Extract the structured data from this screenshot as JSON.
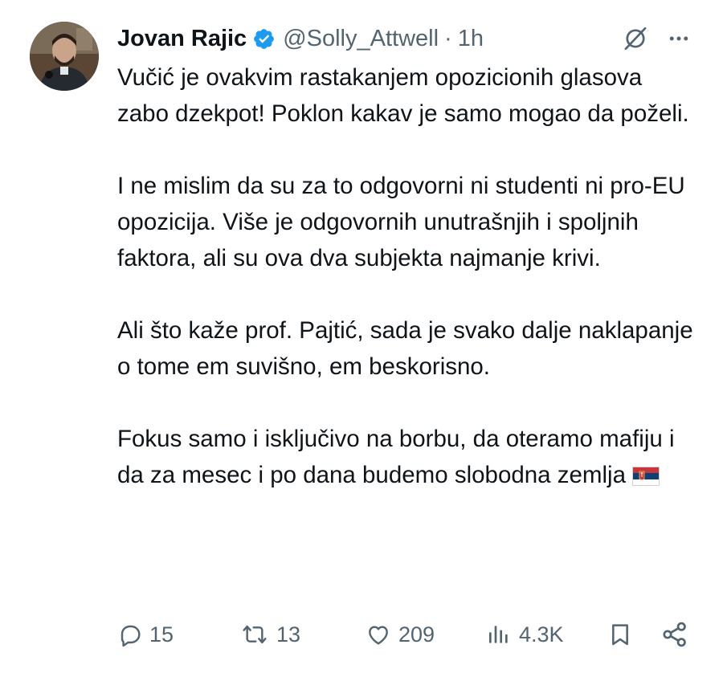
{
  "author": {
    "display_name": "Jovan Rajic",
    "handle": "@Solly_Attwell",
    "separator": "·",
    "time": "1h",
    "verified": true
  },
  "tweet": {
    "paragraphs": [
      "Vučić je ovakvim rastakanjem opozicionih glasova zabo dzekpot! Poklon kakav je samo mogao da poželi.",
      "I ne mislim da su za to odgovorni ni studenti ni pro-EU opozicija. Više je odgovornih unutrašnjih i spoljnih faktora, ali su ova dva subjekta najmanje krivi.",
      "Ali što kaže prof. Pajtić, sada je svako dalje naklapanje o tome em suvišno, em beskorisno.",
      "Fokus samo i isključivo na borbu, da oteramo mafiju i da za mesec i po dana budemo slobodna zemlja"
    ],
    "emoji": "flag-serbia"
  },
  "actions": {
    "replies": "15",
    "reposts": "13",
    "likes": "209",
    "views": "4.3K"
  },
  "colors": {
    "text": "#0f1419",
    "secondary": "#536471",
    "verified_badge": "#1d9bf0",
    "background": "#ffffff"
  },
  "icons": [
    "verified-badge-icon",
    "grok-icon",
    "more-icon",
    "reply-icon",
    "repost-icon",
    "like-icon",
    "views-icon",
    "bookmark-icon",
    "share-icon"
  ]
}
